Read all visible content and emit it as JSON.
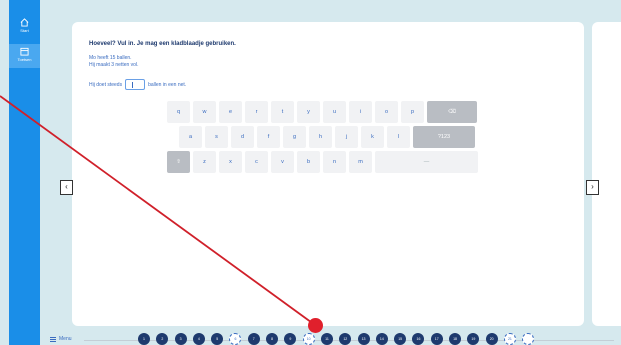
{
  "sidebar": {
    "items": [
      {
        "label": "Start",
        "icon": "home-icon"
      },
      {
        "label": "Toetsen",
        "icon": "calendar-icon"
      }
    ]
  },
  "question": {
    "title": "Hoeveel? Vul in. Je mag een kladblaadje gebruiken.",
    "line1": "Mo heeft 15 ballen.",
    "line2": "Hij maakt 3 netten vol.",
    "answer_prefix": "Hij doet steeds",
    "answer_value": "",
    "answer_suffix": "ballen in een net."
  },
  "keyboard": {
    "row1": [
      "q",
      "w",
      "e",
      "r",
      "t",
      "y",
      "u",
      "i",
      "o",
      "p"
    ],
    "row2": [
      "a",
      "s",
      "d",
      "f",
      "g",
      "h",
      "j",
      "k",
      "l"
    ],
    "row3": [
      "z",
      "x",
      "c",
      "v",
      "b",
      "n",
      "m"
    ],
    "numbers_label": "?123",
    "backspace_symbol": "⌫",
    "shift_symbol": "⇧",
    "space_label": "—"
  },
  "nav": {
    "prev_symbol": "‹",
    "next_symbol": "›"
  },
  "menu": {
    "label": "Menu"
  },
  "pager": {
    "items": [
      {
        "label": "1",
        "state": "filled"
      },
      {
        "label": "2",
        "state": "filled"
      },
      {
        "label": "3",
        "state": "filled"
      },
      {
        "label": "4",
        "state": "filled"
      },
      {
        "label": "5",
        "state": "filled"
      },
      {
        "label": "6",
        "state": "empty"
      },
      {
        "label": "7",
        "state": "filled"
      },
      {
        "label": "8",
        "state": "filled"
      },
      {
        "label": "9",
        "state": "filled"
      },
      {
        "label": "10",
        "state": "empty"
      },
      {
        "label": "11",
        "state": "filled"
      },
      {
        "label": "12",
        "state": "filled"
      },
      {
        "label": "13",
        "state": "filled"
      },
      {
        "label": "14",
        "state": "filled"
      },
      {
        "label": "15",
        "state": "filled"
      },
      {
        "label": "16",
        "state": "filled"
      },
      {
        "label": "17",
        "state": "filled"
      },
      {
        "label": "18",
        "state": "filled"
      },
      {
        "label": "19",
        "state": "filled"
      },
      {
        "label": "20",
        "state": "filled"
      },
      {
        "label": "21",
        "state": "empty"
      },
      {
        "label": "",
        "state": "empty"
      }
    ]
  },
  "colors": {
    "sidebar": "#1a8ee8",
    "accent": "#3a6cc0",
    "pager_filled": "#1e3a6e",
    "annotation": "#e0202c"
  }
}
